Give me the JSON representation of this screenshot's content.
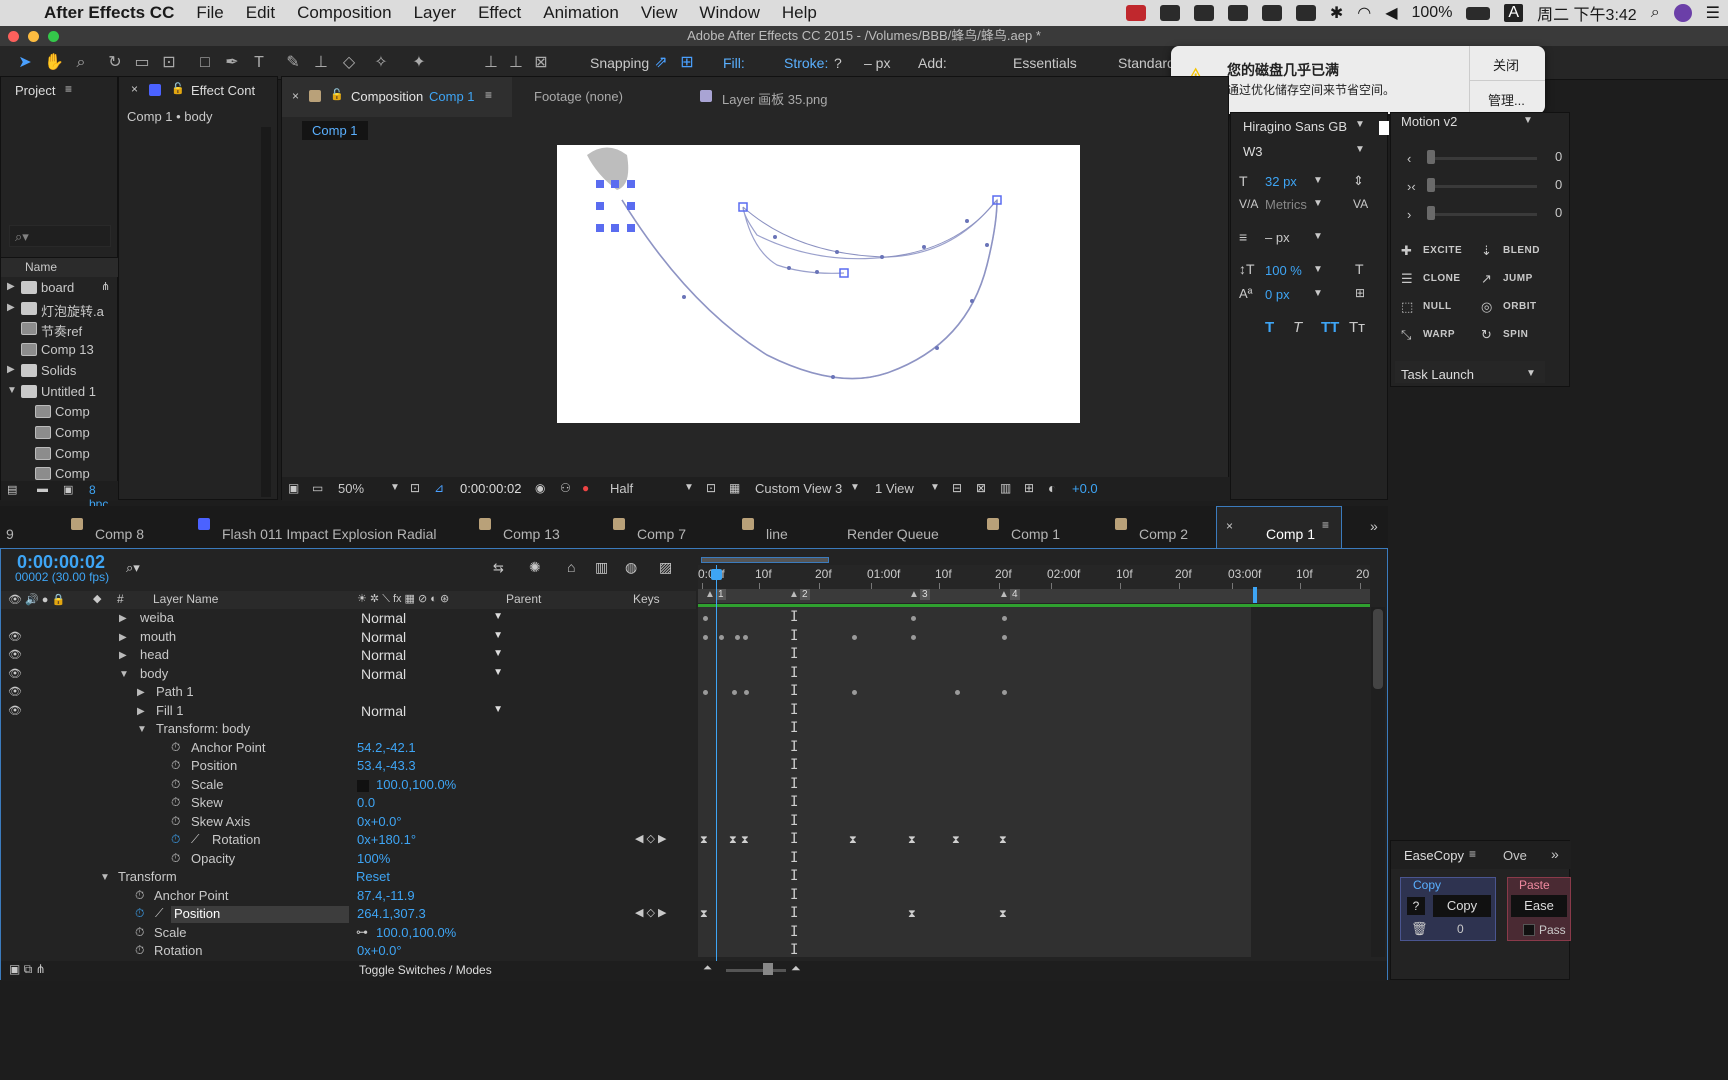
{
  "menubar": {
    "app": "After Effects CC",
    "items": [
      "File",
      "Edit",
      "Composition",
      "Layer",
      "Effect",
      "Animation",
      "View",
      "Window",
      "Help"
    ],
    "battery": "100%",
    "input_method": "A",
    "clock": "周二 下午3:42"
  },
  "window": {
    "title": "Adobe After Effects CC 2015 - /Volumes/BBB/蜂鸟/蜂鸟.aep *"
  },
  "toolbar": {
    "snapping": "Snapping",
    "fill": "Fill:",
    "stroke": "Stroke:",
    "stroke_q": "?",
    "px": "– px",
    "add": "Add:",
    "workspaces": [
      "Essentials",
      "Standard"
    ]
  },
  "notification": {
    "title": "您的磁盘几乎已满",
    "body": "通过优化储存空间来节省空间。",
    "close": "关闭",
    "manage": "管理..."
  },
  "project": {
    "tab": "Project",
    "search_placeholder": "⌕▾",
    "col_name": "Name",
    "items": [
      {
        "name": "board",
        "type": "folder",
        "arrow": "▶"
      },
      {
        "name": "灯泡旋转.a",
        "type": "folder",
        "arrow": "▶"
      },
      {
        "name": "节奏ref",
        "type": "comp",
        "arrow": ""
      },
      {
        "name": "Comp 13",
        "type": "comp",
        "arrow": ""
      },
      {
        "name": "Solids",
        "type": "folder",
        "arrow": "▶"
      },
      {
        "name": "Untitled 1",
        "type": "folder",
        "arrow": "▼"
      },
      {
        "name": "Comp",
        "type": "comp",
        "arrow": ""
      },
      {
        "name": "Comp",
        "type": "comp",
        "arrow": ""
      },
      {
        "name": "Comp",
        "type": "comp",
        "arrow": ""
      },
      {
        "name": "Comp",
        "type": "comp",
        "arrow": ""
      }
    ],
    "bpc": "8 bpc"
  },
  "effect_controls": {
    "tab": "Effect Cont",
    "breadcrumb": "Comp 1 • body"
  },
  "comp_viewer": {
    "tab_prefix": "Composition",
    "tab_comp": "Comp 1",
    "footage_tab": "Footage (none)",
    "layer_tab": "Layer 画板 35.png",
    "active_chip": "Comp 1",
    "zoom": "50%",
    "timecode": "0:00:00:02",
    "resolution": "Half",
    "view": "Custom View 3",
    "views": "1 View",
    "exposure": "+0.0"
  },
  "character": {
    "font": "Hiragino Sans GB",
    "weight": "W3",
    "size": "32 px",
    "kerning": "Metrics",
    "leading": "– px",
    "vscale": "100 %",
    "baseline": "0 px",
    "style_buttons": [
      "T",
      "T",
      "TT",
      "Tт"
    ]
  },
  "motion": {
    "title": "Motion v2",
    "sliders": [
      "0",
      "0",
      "0"
    ],
    "actions": [
      [
        "EXCITE",
        "BLEND"
      ],
      [
        "CLONE",
        "JUMP"
      ],
      [
        "NULL",
        "ORBIT"
      ],
      [
        "WARP",
        "SPIN"
      ]
    ],
    "task": "Task Launch"
  },
  "timeline_tabs": [
    "9",
    "Comp 8",
    "Flash 011 Impact Explosion Radial",
    "Comp 13",
    "Comp 7",
    "line",
    "Render Queue",
    "Comp 1",
    "Comp 2",
    "Comp 1"
  ],
  "timeline": {
    "timecode": "0:00:00:02",
    "frames": "00002 (30.00 fps)",
    "col_layer": "Layer Name",
    "col_parent": "Parent",
    "col_keys": "Keys",
    "col_hash": "#",
    "ruler": [
      "0:00f",
      "10f",
      "20f",
      "01:00f",
      "10f",
      "20f",
      "02:00f",
      "10f",
      "20f",
      "03:00f",
      "10f",
      "20"
    ],
    "markers": [
      "1",
      "2",
      "3",
      "4"
    ],
    "layers": [
      {
        "name": "weiba",
        "mode": "Normal",
        "indent": 0,
        "tw": "▶"
      },
      {
        "name": "mouth",
        "mode": "Normal",
        "indent": 0,
        "tw": "▶"
      },
      {
        "name": "head",
        "mode": "Normal",
        "indent": 0,
        "tw": "▶"
      },
      {
        "name": "body",
        "mode": "Normal",
        "indent": 0,
        "tw": "▼"
      },
      {
        "name": "Path 1",
        "mode": "",
        "indent": 1,
        "tw": "▶"
      },
      {
        "name": "Fill 1",
        "mode": "Normal",
        "indent": 1,
        "tw": "▶"
      },
      {
        "name": "Transform: body",
        "mode": "",
        "indent": 1,
        "tw": "▼"
      }
    ],
    "props": [
      {
        "name": "Anchor Point",
        "value": "54.2,-42.1"
      },
      {
        "name": "Position",
        "value": "53.4,-43.3"
      },
      {
        "name": "Scale",
        "value": "100.0,100.0%"
      },
      {
        "name": "Skew",
        "value": "0.0"
      },
      {
        "name": "Skew Axis",
        "value": "0x+0.0°"
      },
      {
        "name": "Rotation",
        "value": "0x+180.1°"
      },
      {
        "name": "Opacity",
        "value": "100%"
      }
    ],
    "transform_label": "Transform",
    "reset": "Reset",
    "props2": [
      {
        "name": "Anchor Point",
        "value": "87.4,-11.9"
      },
      {
        "name": "Position",
        "value": "264.1,307.3"
      },
      {
        "name": "Scale",
        "value": "100.0,100.0%"
      },
      {
        "name": "Rotation",
        "value": "0x+0.0°"
      }
    ],
    "toggle": "Toggle Switches / Modes"
  },
  "easecopy": {
    "tab": "EaseCopy",
    "tab2": "Ove",
    "copy_label": "Copy",
    "paste_label": "Paste",
    "copy_btn": "Copy",
    "ease_btn": "Ease",
    "q": "?",
    "num": "0",
    "pass": "Pass"
  }
}
